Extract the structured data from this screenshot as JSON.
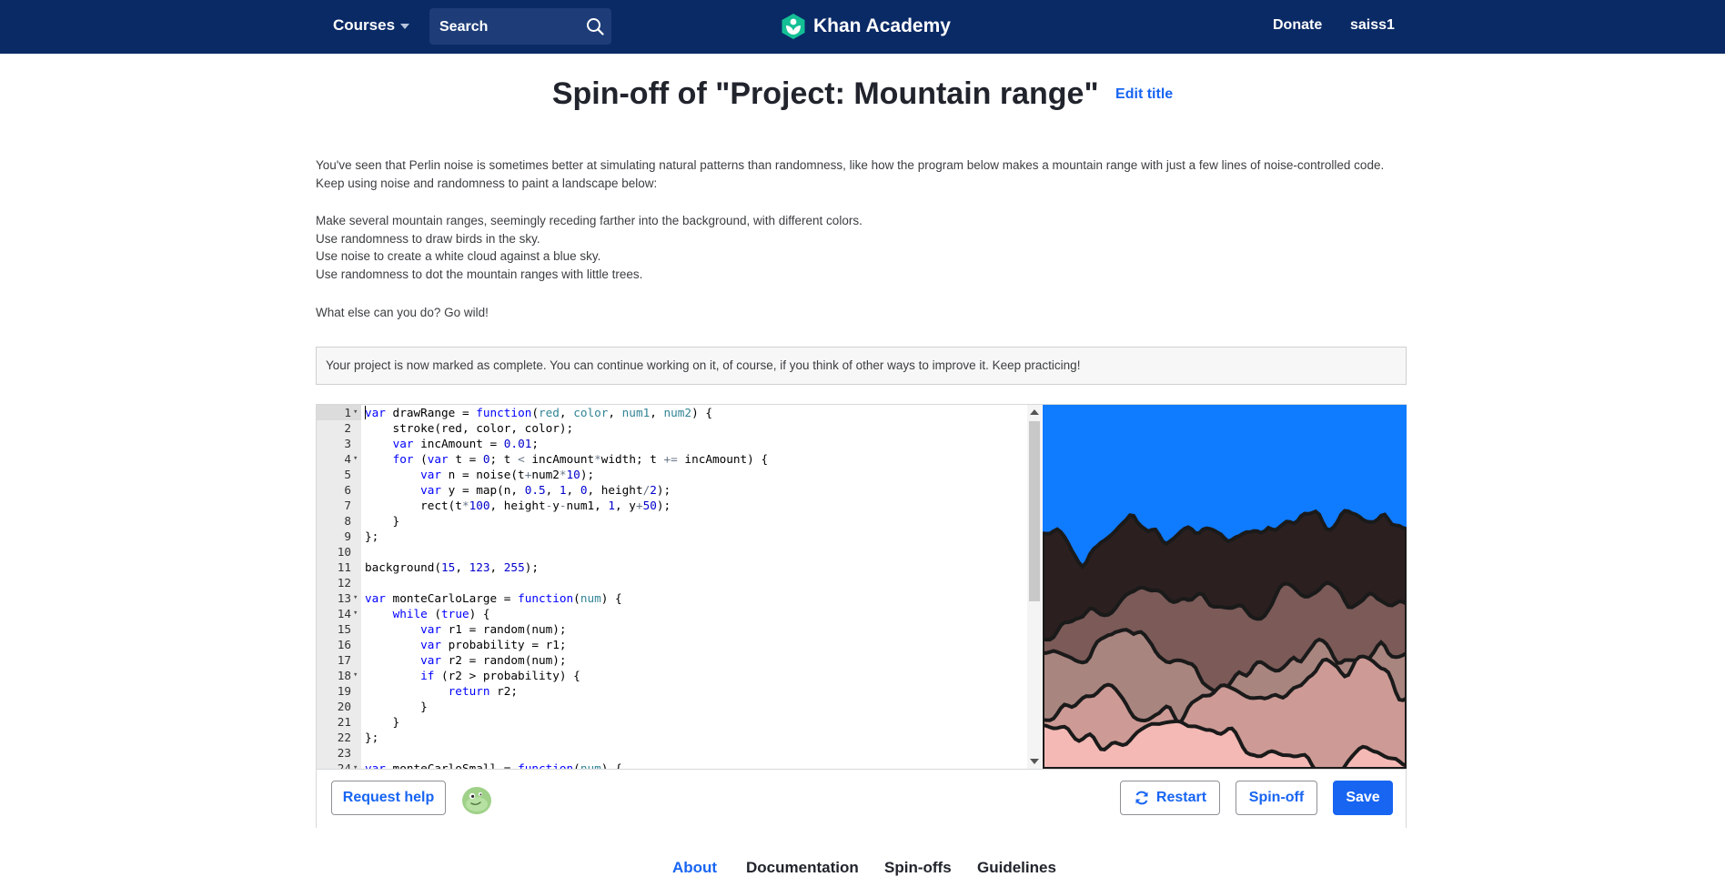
{
  "nav": {
    "courses_label": "Courses",
    "search_placeholder": "Search",
    "brand_name": "Khan Academy",
    "donate_label": "Donate",
    "username": "saiss1",
    "colors": {
      "nav_bg": "#0a2a66",
      "brand_green": "#14bf96"
    }
  },
  "page": {
    "title": "Spin-off of \"Project: Mountain range\"",
    "edit_title_label": "Edit title",
    "description": {
      "intro": "You've seen that Perlin noise is sometimes better at simulating natural patterns than randomness, like how the program below makes a mountain range with just a few lines of noise-controlled code. Keep using noise and randomness to paint a landscape below:",
      "steps": [
        "Make several mountain ranges, seemingly receding farther into the background, with different colors.",
        "Use randomness to draw birds in the sky.",
        "Use noise to create a white cloud against a blue sky.",
        "Use randomness to dot the mountain ranges with little trees."
      ],
      "closing": "What else can you do? Go wild!"
    },
    "complete_message": "Your project is now marked as complete. You can continue working on it, of course, if you think of other ways to improve it. Keep practicing!"
  },
  "editor": {
    "active_line": 1,
    "lines": [
      {
        "n": "1",
        "fold": true,
        "code": "var drawRange = function(red, color, num1, num2) {"
      },
      {
        "n": "2",
        "fold": false,
        "code": "    stroke(red, color, color);"
      },
      {
        "n": "3",
        "fold": false,
        "code": "    var incAmount = 0.01;"
      },
      {
        "n": "4",
        "fold": true,
        "code": "    for (var t = 0; t < incAmount*width; t += incAmount) {"
      },
      {
        "n": "5",
        "fold": false,
        "code": "        var n = noise(t+num2*10);"
      },
      {
        "n": "6",
        "fold": false,
        "code": "        var y = map(n, 0.5, 1, 0, height/2);"
      },
      {
        "n": "7",
        "fold": false,
        "code": "        rect(t*100, height-y-num1, 1, y+50);"
      },
      {
        "n": "8",
        "fold": false,
        "code": "    }"
      },
      {
        "n": "9",
        "fold": false,
        "code": "};"
      },
      {
        "n": "10",
        "fold": false,
        "code": ""
      },
      {
        "n": "11",
        "fold": false,
        "code": "background(15, 123, 255);"
      },
      {
        "n": "12",
        "fold": false,
        "code": ""
      },
      {
        "n": "13",
        "fold": true,
        "code": "var monteCarloLarge = function(num) {"
      },
      {
        "n": "14",
        "fold": true,
        "code": "    while (true) {"
      },
      {
        "n": "15",
        "fold": false,
        "code": "        var r1 = random(num);"
      },
      {
        "n": "16",
        "fold": false,
        "code": "        var probability = r1;"
      },
      {
        "n": "17",
        "fold": false,
        "code": "        var r2 = random(num);"
      },
      {
        "n": "18",
        "fold": true,
        "code": "        if (r2 > probability) {"
      },
      {
        "n": "19",
        "fold": false,
        "code": "            return r2;"
      },
      {
        "n": "20",
        "fold": false,
        "code": "        }"
      },
      {
        "n": "21",
        "fold": false,
        "code": "    }"
      },
      {
        "n": "22",
        "fold": false,
        "code": "};"
      },
      {
        "n": "23",
        "fold": false,
        "code": ""
      },
      {
        "n": "24",
        "fold": true,
        "code": "var monteCarloSmall = function(num) {"
      }
    ],
    "canvas_colors": {
      "sky": "#0f7bff",
      "range1": "#2b1f1f",
      "range2": "#7b5a58",
      "range3": "#a98580",
      "range4": "#cd9a95",
      "range5": "#f4b9b5",
      "outline": "#1a1a1a"
    }
  },
  "toolbar": {
    "request_help_label": "Request help",
    "restart_label": "Restart",
    "spinoff_label": "Spin-off",
    "save_label": "Save"
  },
  "tabs": [
    {
      "label": "About",
      "active": true
    },
    {
      "label": "Documentation",
      "active": false
    },
    {
      "label": "Spin-offs",
      "active": false
    },
    {
      "label": "Guidelines",
      "active": false
    }
  ]
}
